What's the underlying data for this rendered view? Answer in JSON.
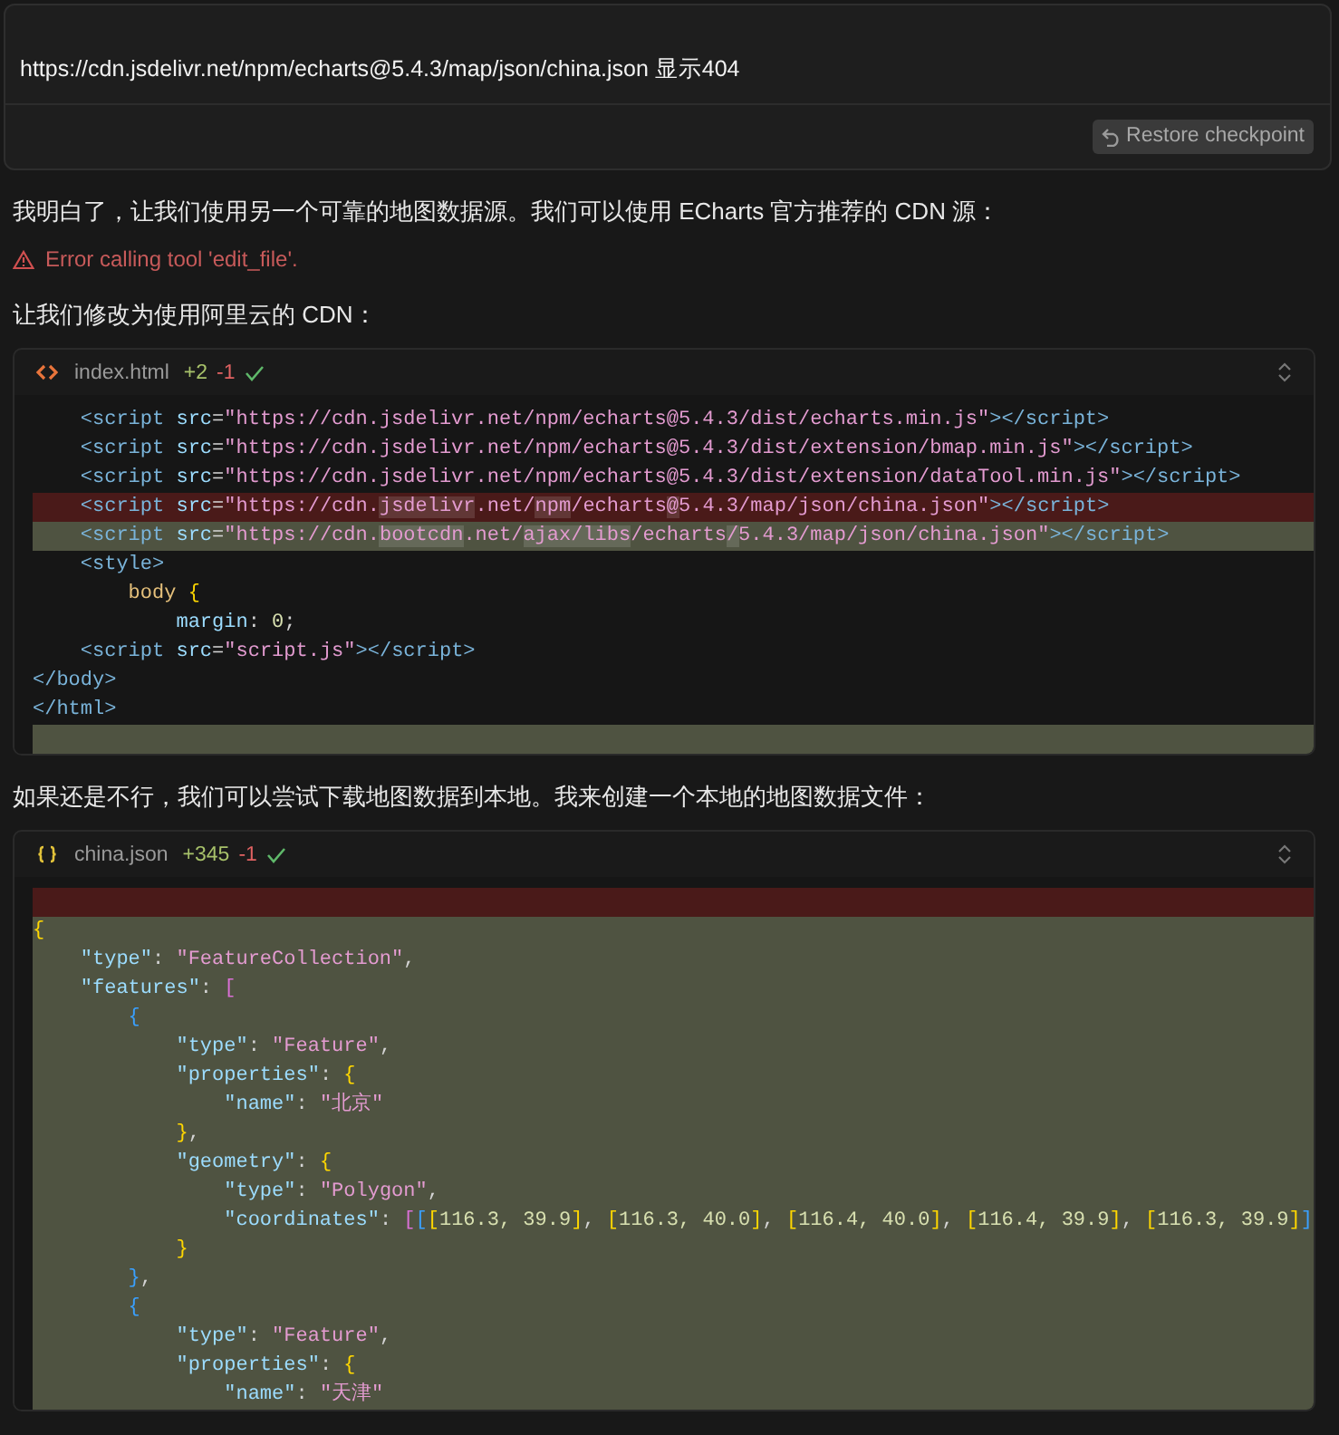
{
  "prompt": {
    "text": "https://cdn.jsdelivr.net/npm/echarts@5.4.3/map/json/china.json 显示404",
    "restore_button": "Restore checkpoint"
  },
  "messages": [
    {
      "kind": "text",
      "text": "我明白了，让我们使用另一个可靠的地图数据源。我们可以使用 ECharts 官方推荐的 CDN 源："
    },
    {
      "kind": "error",
      "text": "Error calling tool 'edit_file'."
    },
    {
      "kind": "text",
      "text": "让我们修改为使用阿里云的 CDN："
    },
    {
      "kind": "code",
      "file": {
        "name": "index.html",
        "kind": "html",
        "added": "+2",
        "removed": "-1",
        "applied": true
      },
      "lines": [
        {
          "kind": "ctx",
          "segments": [
            {
              "text": "    <script",
              "kind": "tag"
            },
            {
              "text": " src",
              "kind": "attr"
            },
            {
              "text": "=",
              "kind": "punct"
            },
            {
              "text": "\"https://cdn.jsdelivr.net/npm/echarts@5.4.3/dist/echarts.min.js\"",
              "kind": "str"
            },
            {
              "text": "></script>",
              "kind": "tag"
            }
          ]
        },
        {
          "kind": "ctx",
          "segments": [
            {
              "text": "    <script",
              "kind": "tag"
            },
            {
              "text": " src",
              "kind": "attr"
            },
            {
              "text": "=",
              "kind": "punct"
            },
            {
              "text": "\"https://cdn.jsdelivr.net/npm/echarts@5.4.3/dist/extension/bmap.min.js\"",
              "kind": "str"
            },
            {
              "text": "></script>",
              "kind": "tag"
            }
          ]
        },
        {
          "kind": "ctx",
          "segments": [
            {
              "text": "    <script",
              "kind": "tag"
            },
            {
              "text": " src",
              "kind": "attr"
            },
            {
              "text": "=",
              "kind": "punct"
            },
            {
              "text": "\"https://cdn.jsdelivr.net/npm/echarts@5.4.3/dist/extension/dataTool.min.js\"",
              "kind": "str"
            },
            {
              "text": "></script>",
              "kind": "tag"
            }
          ]
        },
        {
          "kind": "del",
          "segments": [
            {
              "text": "    <script",
              "kind": "tag"
            },
            {
              "text": " src",
              "kind": "attr"
            },
            {
              "text": "=",
              "kind": "punct"
            },
            {
              "text": "\"https://cdn.",
              "kind": "str"
            },
            {
              "text": "jsdelivr",
              "kind": "strmark"
            },
            {
              "text": ".net/",
              "kind": "str"
            },
            {
              "text": "npm",
              "kind": "strmark"
            },
            {
              "text": "/echarts",
              "kind": "str"
            },
            {
              "text": "@",
              "kind": "strmark"
            },
            {
              "text": "5.4.3/map/json/china.json\"",
              "kind": "str"
            },
            {
              "text": "></script>",
              "kind": "tag"
            }
          ]
        },
        {
          "kind": "add",
          "segments": [
            {
              "text": "    <script",
              "kind": "tag"
            },
            {
              "text": " src",
              "kind": "attr"
            },
            {
              "text": "=",
              "kind": "punct"
            },
            {
              "text": "\"https://cdn.",
              "kind": "str"
            },
            {
              "text": "bootcdn",
              "kind": "strmark"
            },
            {
              "text": ".net/",
              "kind": "str"
            },
            {
              "text": "ajax/libs",
              "kind": "strmark"
            },
            {
              "text": "/echarts",
              "kind": "str"
            },
            {
              "text": "/",
              "kind": "strmark"
            },
            {
              "text": "5.4.3/map/json/china.json\"",
              "kind": "str"
            },
            {
              "text": "></script>",
              "kind": "tag"
            }
          ]
        },
        {
          "kind": "ctx",
          "segments": [
            {
              "text": "    <style>",
              "kind": "tag"
            }
          ]
        },
        {
          "kind": "ctx",
          "segments": [
            {
              "text": "        body",
              "kind": "sel"
            },
            {
              "text": " {",
              "kind": "b1"
            }
          ]
        },
        {
          "kind": "ctx",
          "segments": [
            {
              "text": "            margin",
              "kind": "attr"
            },
            {
              "text": ": ",
              "kind": "punct"
            },
            {
              "text": "0",
              "kind": "num"
            },
            {
              "text": ";",
              "kind": "punct"
            }
          ]
        },
        {
          "kind": "ctx",
          "segments": [
            {
              "text": "    <script",
              "kind": "tag"
            },
            {
              "text": " src",
              "kind": "attr"
            },
            {
              "text": "=",
              "kind": "punct"
            },
            {
              "text": "\"script.js\"",
              "kind": "str"
            },
            {
              "text": "></script>",
              "kind": "tag"
            }
          ]
        },
        {
          "kind": "ctx",
          "segments": [
            {
              "text": "</body>",
              "kind": "tag"
            }
          ]
        },
        {
          "kind": "ctx",
          "segments": [
            {
              "text": "</html>",
              "kind": "tag"
            }
          ]
        },
        {
          "kind": "add"
        }
      ]
    },
    {
      "kind": "text",
      "text": "如果还是不行，我们可以尝试下载地图数据到本地。我来创建一个本地的地图数据文件："
    },
    {
      "kind": "code",
      "file": {
        "name": "china.json",
        "kind": "json",
        "added": "+345",
        "removed": "-1",
        "applied": true
      },
      "lines": [
        {
          "kind": "del"
        },
        {
          "kind": "add",
          "segments": [
            {
              "text": "{",
              "kind": "b1"
            }
          ]
        },
        {
          "kind": "add",
          "segments": [
            {
              "text": "    \"type\"",
              "kind": "attr"
            },
            {
              "text": ": ",
              "kind": "punct"
            },
            {
              "text": "\"FeatureCollection\"",
              "kind": "str"
            },
            {
              "text": ",",
              "kind": "punct"
            }
          ]
        },
        {
          "kind": "add",
          "segments": [
            {
              "text": "    \"features\"",
              "kind": "attr"
            },
            {
              "text": ": ",
              "kind": "punct"
            },
            {
              "text": "[",
              "kind": "b2"
            }
          ]
        },
        {
          "kind": "add",
          "segments": [
            {
              "text": "        {",
              "kind": "b3"
            }
          ]
        },
        {
          "kind": "add",
          "segments": [
            {
              "text": "            \"type\"",
              "kind": "attr"
            },
            {
              "text": ": ",
              "kind": "punct"
            },
            {
              "text": "\"Feature\"",
              "kind": "str"
            },
            {
              "text": ",",
              "kind": "punct"
            }
          ]
        },
        {
          "kind": "add",
          "segments": [
            {
              "text": "            \"properties\"",
              "kind": "attr"
            },
            {
              "text": ": ",
              "kind": "punct"
            },
            {
              "text": "{",
              "kind": "b1"
            }
          ]
        },
        {
          "kind": "add",
          "segments": [
            {
              "text": "                \"name\"",
              "kind": "attr"
            },
            {
              "text": ": ",
              "kind": "punct"
            },
            {
              "text": "\"北京\"",
              "kind": "str"
            }
          ]
        },
        {
          "kind": "add",
          "segments": [
            {
              "text": "            }",
              "kind": "b1"
            },
            {
              "text": ",",
              "kind": "punct"
            }
          ]
        },
        {
          "kind": "add",
          "segments": [
            {
              "text": "            \"geometry\"",
              "kind": "attr"
            },
            {
              "text": ": ",
              "kind": "punct"
            },
            {
              "text": "{",
              "kind": "b1"
            }
          ]
        },
        {
          "kind": "add",
          "segments": [
            {
              "text": "                \"type\"",
              "kind": "attr"
            },
            {
              "text": ": ",
              "kind": "punct"
            },
            {
              "text": "\"Polygon\"",
              "kind": "str"
            },
            {
              "text": ",",
              "kind": "punct"
            }
          ]
        },
        {
          "kind": "add",
          "segments": [
            {
              "text": "                \"coordinates\"",
              "kind": "attr"
            },
            {
              "text": ": ",
              "kind": "punct"
            },
            {
              "text": "[",
              "kind": "b2"
            },
            {
              "text": "[",
              "kind": "b3"
            },
            {
              "text": "[",
              "kind": "b1"
            },
            {
              "text": "116.3, 39.9",
              "kind": "num"
            },
            {
              "text": "]",
              "kind": "b1"
            },
            {
              "text": ", ",
              "kind": "punct"
            },
            {
              "text": "[",
              "kind": "b1"
            },
            {
              "text": "116.3, 40.0",
              "kind": "num"
            },
            {
              "text": "]",
              "kind": "b1"
            },
            {
              "text": ", ",
              "kind": "punct"
            },
            {
              "text": "[",
              "kind": "b1"
            },
            {
              "text": "116.4, 40.0",
              "kind": "num"
            },
            {
              "text": "]",
              "kind": "b1"
            },
            {
              "text": ", ",
              "kind": "punct"
            },
            {
              "text": "[",
              "kind": "b1"
            },
            {
              "text": "116.4, 39.9",
              "kind": "num"
            },
            {
              "text": "]",
              "kind": "b1"
            },
            {
              "text": ", ",
              "kind": "punct"
            },
            {
              "text": "[",
              "kind": "b1"
            },
            {
              "text": "116.3, 39.9",
              "kind": "num"
            },
            {
              "text": "]",
              "kind": "b1"
            },
            {
              "text": "]",
              "kind": "b3"
            }
          ]
        },
        {
          "kind": "add",
          "segments": [
            {
              "text": "            }",
              "kind": "b1"
            }
          ]
        },
        {
          "kind": "add",
          "segments": [
            {
              "text": "        }",
              "kind": "b3"
            },
            {
              "text": ",",
              "kind": "punct"
            }
          ]
        },
        {
          "kind": "add",
          "segments": [
            {
              "text": "        {",
              "kind": "b3"
            }
          ]
        },
        {
          "kind": "add",
          "segments": [
            {
              "text": "            \"type\"",
              "kind": "attr"
            },
            {
              "text": ": ",
              "kind": "punct"
            },
            {
              "text": "\"Feature\"",
              "kind": "str"
            },
            {
              "text": ",",
              "kind": "punct"
            }
          ]
        },
        {
          "kind": "add",
          "segments": [
            {
              "text": "            \"properties\"",
              "kind": "attr"
            },
            {
              "text": ": ",
              "kind": "punct"
            },
            {
              "text": "{",
              "kind": "b1"
            }
          ]
        },
        {
          "kind": "add",
          "segments": [
            {
              "text": "                \"name\"",
              "kind": "attr"
            },
            {
              "text": ": ",
              "kind": "punct"
            },
            {
              "text": "\"天津\"",
              "kind": "str"
            }
          ]
        }
      ]
    }
  ]
}
